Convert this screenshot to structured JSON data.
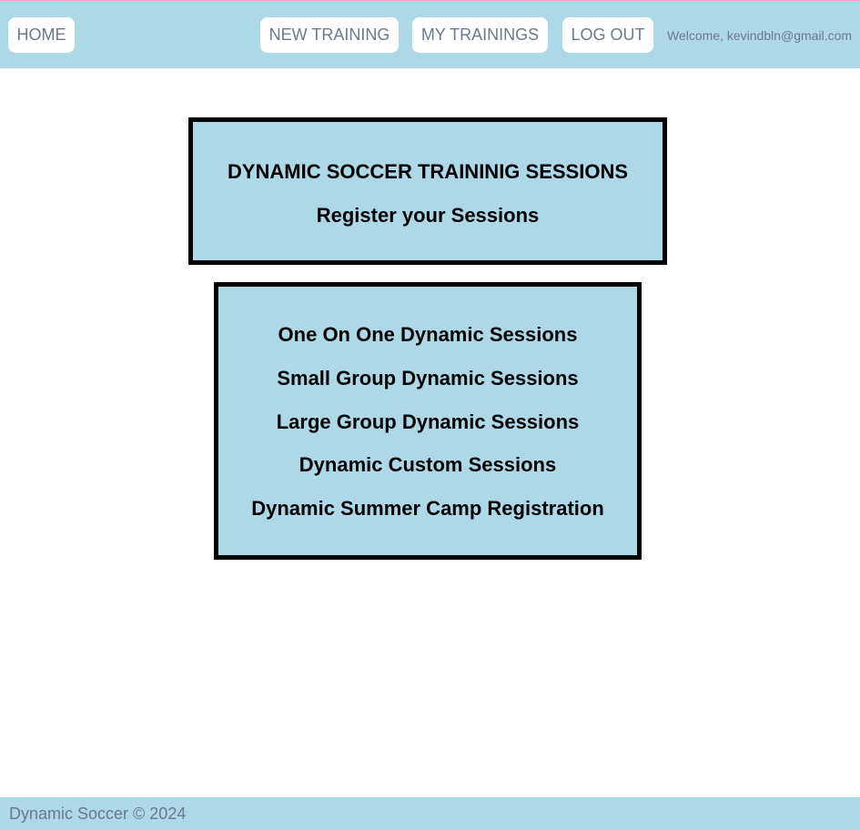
{
  "nav": {
    "home": "HOME",
    "new_training": "NEW TRAINING",
    "my_trainings": "MY TRAININGS",
    "log_out": "LOG OUT",
    "welcome": "Welcome, kevindbln@gmail.com"
  },
  "header": {
    "title": "DYNAMIC SOCCER TRAININIG SESSIONS",
    "subtitle": "Register your Sessions"
  },
  "sessions": [
    "One On One Dynamic Sessions",
    "Small Group Dynamic Sessions",
    "Large Group Dynamic Sessions",
    "Dynamic Custom Sessions",
    "Dynamic Summer Camp Registration"
  ],
  "footer": {
    "text": "Dynamic Soccer © 2024"
  },
  "colors": {
    "bar_background": "#add8e6",
    "box_background": "#add8e6",
    "box_border": "#000000",
    "nav_text": "#6b7a8c"
  }
}
